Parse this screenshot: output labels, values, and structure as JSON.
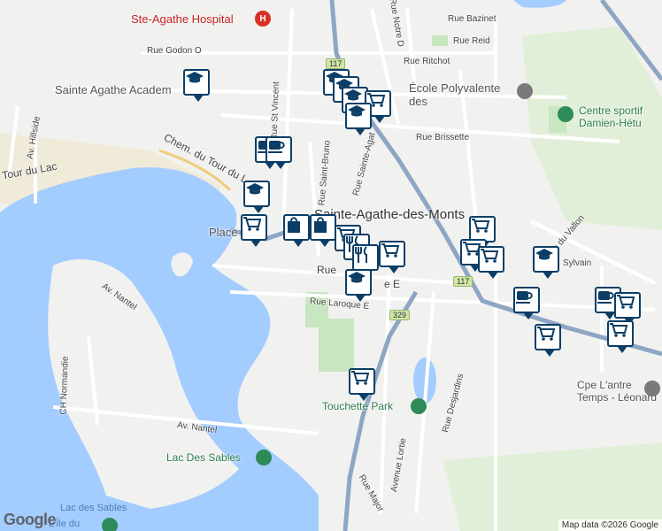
{
  "map": {
    "labels": {
      "hospital": "Ste-Agathe Hospital",
      "hospital_icon": "H",
      "academy": "Sainte Agathe Academ",
      "school": "École Polyvalente des",
      "sports": "Centre sportif Damien-Hétu",
      "town": "Sainte-Agathe-des-Monts",
      "place": "Place",
      "park": "Touchette Park",
      "lake": "Lac Des Sables",
      "lake_water": "Lac des Sables",
      "ile": "L'Île du",
      "cpe": "Cpe L'antre Temps - Léonard"
    },
    "streets": {
      "bazinet": "Rue Bazinet",
      "reid": "Rue Reid",
      "ritchot": "Rue Ritchot",
      "godon": "Rue Godon O",
      "st_vincent": "Rue St Vincent",
      "notre_dame": "Rue Notre D",
      "brissette": "Rue Brissette",
      "tour_du_lac": "Chem. du Tour du L",
      "tour_du_lac_w": "Tour du Lac",
      "hillside": "Av. Hillside",
      "st_bruno": "Rue Saint-Bruno",
      "ste_agathe": "Rue Sainte-Agat",
      "vallon": "e du Vallon",
      "sylvain": "Sylvain",
      "rue_e": "Rue",
      "rue_e2": "e E",
      "laroque": "Rue Laroque E",
      "nantel_av": "Av. Nantel",
      "normandie": "CH Normandie",
      "nantel": "Av. Nantel",
      "desjardins": "Rue Desjardins",
      "lortie": "Avenue Lortie",
      "major": "Rue Major"
    },
    "shields": {
      "r117a": "117",
      "r117b": "117",
      "r329": "329"
    },
    "markers": [
      {
        "icon": "school-icon"
      },
      {
        "icon": "school-icon"
      },
      {
        "icon": "school-icon"
      },
      {
        "icon": "school-icon"
      },
      {
        "icon": "grocery-cart-icon"
      },
      {
        "icon": "school-icon"
      },
      {
        "icon": "cafe-icon"
      },
      {
        "icon": "cafe-icon"
      },
      {
        "icon": "school-icon"
      },
      {
        "icon": "grocery-cart-icon"
      },
      {
        "icon": "shopping-bag-icon"
      },
      {
        "icon": "shopping-bag-icon"
      },
      {
        "icon": "grocery-cart-icon"
      },
      {
        "icon": "restaurant-icon"
      },
      {
        "icon": "restaurant-icon"
      },
      {
        "icon": "grocery-cart-icon"
      },
      {
        "icon": "school-icon"
      },
      {
        "icon": "grocery-cart-icon"
      },
      {
        "icon": "grocery-cart-icon"
      },
      {
        "icon": "grocery-cart-icon"
      },
      {
        "icon": "school-icon"
      },
      {
        "icon": "cafe-icon"
      },
      {
        "icon": "grocery-cart-icon"
      },
      {
        "icon": "cafe-icon"
      },
      {
        "icon": "grocery-cart-icon"
      },
      {
        "icon": "grocery-cart-icon"
      },
      {
        "icon": "grocery-cart-icon"
      }
    ],
    "branding": {
      "logo": "Google",
      "attribution": "Map data ©2026 Google"
    },
    "colors": {
      "water": "#a3ccff",
      "park": "#c8e6c0",
      "highway": "#8ea6c4",
      "marker": "#0b3e66"
    }
  }
}
